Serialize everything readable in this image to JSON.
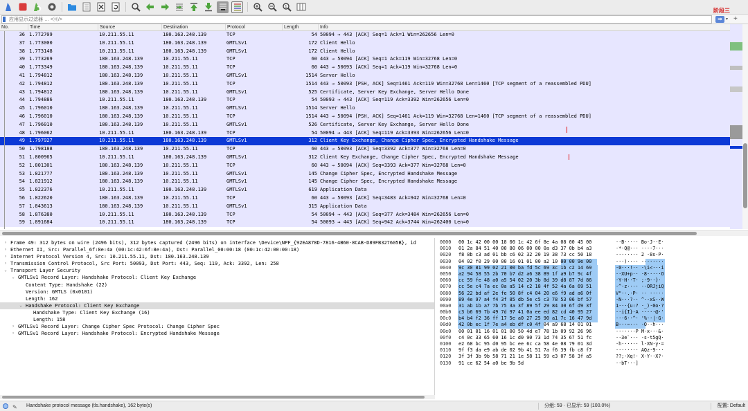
{
  "toolbar": {
    "icons": [
      "shark-fin-start-icon",
      "stop-square-icon",
      "restart-fin-icon",
      "capture-options-gear-icon",
      "open-folder-icon",
      "save-file-icon",
      "close-file-icon",
      "reload-icon",
      "find-packet-icon",
      "go-back-icon",
      "go-forward-icon",
      "go-to-packet-icon",
      "go-first-icon",
      "go-last-icon",
      "autoscroll-icon",
      "colorize-icon",
      "zoom-in-icon",
      "zoom-out-icon",
      "zoom-reset-icon",
      "resize-columns-icon"
    ],
    "stage_label": "阶段三"
  },
  "filter": {
    "placeholder": "应用显示过滤器 … <⌘/>",
    "apply_glyph": "➡"
  },
  "columns": [
    "No.",
    "Time",
    "Source",
    "Destination",
    "Protocol",
    "Length",
    "Info"
  ],
  "packets": [
    {
      "no": "36",
      "time": "1.772709",
      "src": "10.211.55.11",
      "dst": "180.163.248.139",
      "proto": "TCP",
      "len": "54",
      "info": "50094 → 443 [ACK] Seq=1 Ack=1 Win=262656 Len=0"
    },
    {
      "no": "37",
      "time": "1.773000",
      "src": "10.211.55.11",
      "dst": "180.163.248.139",
      "proto": "GMTLSv1",
      "len": "172",
      "info": "Client Hello"
    },
    {
      "no": "38",
      "time": "1.773148",
      "src": "10.211.55.11",
      "dst": "180.163.248.139",
      "proto": "GMTLSv1",
      "len": "172",
      "info": "Client Hello"
    },
    {
      "no": "39",
      "time": "1.773269",
      "src": "180.163.248.139",
      "dst": "10.211.55.11",
      "proto": "TCP",
      "len": "60",
      "info": "443 → 50094 [ACK] Seq=1 Ack=119 Win=32768 Len=0"
    },
    {
      "no": "40",
      "time": "1.773349",
      "src": "180.163.248.139",
      "dst": "10.211.55.11",
      "proto": "TCP",
      "len": "60",
      "info": "443 → 50093 [ACK] Seq=1 Ack=119 Win=32768 Len=0"
    },
    {
      "no": "41",
      "time": "1.794812",
      "src": "180.163.248.139",
      "dst": "10.211.55.11",
      "proto": "GMTLSv1",
      "len": "1514",
      "info": "Server Hello"
    },
    {
      "no": "42",
      "time": "1.794812",
      "src": "180.163.248.139",
      "dst": "10.211.55.11",
      "proto": "TCP",
      "len": "1514",
      "info": "443 → 50093 [PSH, ACK] Seq=1461 Ack=119 Win=32768 Len=1460 [TCP segment of a reassembled PDU]"
    },
    {
      "no": "43",
      "time": "1.794812",
      "src": "180.163.248.139",
      "dst": "10.211.55.11",
      "proto": "GMTLSv1",
      "len": "525",
      "info": "Certificate, Server Key Exchange, Server Hello Done"
    },
    {
      "no": "44",
      "time": "1.794886",
      "src": "10.211.55.11",
      "dst": "180.163.248.139",
      "proto": "TCP",
      "len": "54",
      "info": "50093 → 443 [ACK] Seq=119 Ack=3392 Win=262656 Len=0"
    },
    {
      "no": "45",
      "time": "1.796010",
      "src": "180.163.248.139",
      "dst": "10.211.55.11",
      "proto": "GMTLSv1",
      "len": "1514",
      "info": "Server Hello"
    },
    {
      "no": "46",
      "time": "1.796010",
      "src": "180.163.248.139",
      "dst": "10.211.55.11",
      "proto": "TCP",
      "len": "1514",
      "info": "443 → 50094 [PSH, ACK] Seq=1461 Ack=119 Win=32768 Len=1460 [TCP segment of a reassembled PDU]"
    },
    {
      "no": "47",
      "time": "1.796010",
      "src": "180.163.248.139",
      "dst": "10.211.55.11",
      "proto": "GMTLSv1",
      "len": "526",
      "info": "Certificate, Server Key Exchange, Server Hello Done"
    },
    {
      "no": "48",
      "time": "1.796062",
      "src": "10.211.55.11",
      "dst": "180.163.248.139",
      "proto": "TCP",
      "len": "54",
      "info": "50094 → 443 [ACK] Seq=119 Ack=3393 Win=262656 Len=0"
    },
    {
      "no": "49",
      "time": "1.797927",
      "src": "10.211.55.11",
      "dst": "180.163.248.139",
      "proto": "GMTLSv1",
      "len": "312",
      "info": "Client Key Exchange, Change Cipher Spec, Encrypted Handshake Message"
    },
    {
      "no": "50",
      "time": "1.798188",
      "src": "180.163.248.139",
      "dst": "10.211.55.11",
      "proto": "TCP",
      "len": "60",
      "info": "443 → 50093 [ACK] Seq=3392 Ack=377 Win=32768 Len=0"
    },
    {
      "no": "51",
      "time": "1.800965",
      "src": "10.211.55.11",
      "dst": "180.163.248.139",
      "proto": "GMTLSv1",
      "len": "312",
      "info": "Client Key Exchange, Change Cipher Spec, Encrypted Handshake Message"
    },
    {
      "no": "52",
      "time": "1.801301",
      "src": "180.163.248.139",
      "dst": "10.211.55.11",
      "proto": "TCP",
      "len": "60",
      "info": "443 → 50094 [ACK] Seq=3393 Ack=377 Win=32768 Len=0"
    },
    {
      "no": "53",
      "time": "1.821777",
      "src": "180.163.248.139",
      "dst": "10.211.55.11",
      "proto": "GMTLSv1",
      "len": "145",
      "info": "Change Cipher Spec, Encrypted Handshake Message"
    },
    {
      "no": "54",
      "time": "1.821912",
      "src": "180.163.248.139",
      "dst": "10.211.55.11",
      "proto": "GMTLSv1",
      "len": "145",
      "info": "Change Cipher Spec, Encrypted Handshake Message"
    },
    {
      "no": "55",
      "time": "1.822376",
      "src": "10.211.55.11",
      "dst": "180.163.248.139",
      "proto": "GMTLSv1",
      "len": "619",
      "info": "Application Data"
    },
    {
      "no": "56",
      "time": "1.822620",
      "src": "180.163.248.139",
      "dst": "10.211.55.11",
      "proto": "TCP",
      "len": "60",
      "info": "443 → 50093 [ACK] Seq=3483 Ack=942 Win=32768 Len=0"
    },
    {
      "no": "57",
      "time": "1.843613",
      "src": "180.163.248.139",
      "dst": "10.211.55.11",
      "proto": "GMTLSv1",
      "len": "315",
      "info": "Application Data"
    },
    {
      "no": "58",
      "time": "1.876380",
      "src": "10.211.55.11",
      "dst": "180.163.248.139",
      "proto": "TCP",
      "len": "54",
      "info": "50094 → 443 [ACK] Seq=377 Ack=3484 Win=262656 Len=0"
    },
    {
      "no": "59",
      "time": "1.891684",
      "src": "10.211.55.11",
      "dst": "180.163.248.139",
      "proto": "TCP",
      "len": "54",
      "info": "50093 → 443 [ACK] Seq=942 Ack=3744 Win=262400 Len=0"
    }
  ],
  "selected_packet": "49",
  "details": [
    {
      "indent": 0,
      "arrow": "›",
      "text": "Frame 49: 312 bytes on wire (2496 bits), 312 bytes captured (2496 bits) on interface \\Device\\NPF_{92EA878D-7816-4B60-8CAB-D89FB327605B}, id"
    },
    {
      "indent": 0,
      "arrow": "›",
      "text": "Ethernet II, Src: Parallel_6f:8e:4a (00:1c:42:6f:8e:4a), Dst: Parallel_00:00:18 (00:1c:42:00:00:18)"
    },
    {
      "indent": 0,
      "arrow": "›",
      "text": "Internet Protocol Version 4, Src: 10.211.55.11, Dst: 180.163.248.139"
    },
    {
      "indent": 0,
      "arrow": "›",
      "text": "Transmission Control Protocol, Src Port: 50093, Dst Port: 443, Seq: 119, Ack: 3392, Len: 258"
    },
    {
      "indent": 0,
      "arrow": "⌄",
      "text": "Transport Layer Security"
    },
    {
      "indent": 1,
      "arrow": "⌄",
      "text": "GMTLSv1 Record Layer: Handshake Protocol: Client Key Exchange"
    },
    {
      "indent": 2,
      "arrow": "",
      "text": "Content Type: Handshake (22)"
    },
    {
      "indent": 2,
      "arrow": "",
      "text": "Version: GMTLS (0x0101)"
    },
    {
      "indent": 2,
      "arrow": "",
      "text": "Length: 162"
    },
    {
      "indent": 2,
      "arrow": "⌄",
      "text": "Handshake Protocol: Client Key Exchange",
      "highlight": true
    },
    {
      "indent": 3,
      "arrow": "",
      "text": "Handshake Type: Client Key Exchange (16)"
    },
    {
      "indent": 3,
      "arrow": "",
      "text": "Length: 158"
    },
    {
      "indent": 1,
      "arrow": "›",
      "text": "GMTLSv1 Record Layer: Change Cipher Spec Protocol: Change Cipher Spec"
    },
    {
      "indent": 1,
      "arrow": "›",
      "text": "GMTLSv1 Record Layer: Handshake Protocol: Encrypted Handshake Message"
    }
  ],
  "bytes": [
    {
      "off": "0000",
      "hex": "00 1c 42 00 00 18 00 1c  42 6f 8e 4a 08 00 45 00",
      "ascii": "··B····· Bo·J··E·"
    },
    {
      "off": "0010",
      "hex": "01 2a 84 51 40 00 80 06  00 00 0a d3 37 0b b4 a3",
      "ascii": "·*·Q@··· ····7···"
    },
    {
      "off": "0020",
      "hex": "f8 8b c3 ad 01 bb c6 02  32 20 19 38 73 cc 50 18",
      "ascii": "········ 2 ·8s·P·"
    },
    {
      "off": "0030",
      "hex": "04 02 f0 29 00 00 16 01  01 00 a2 10 00 00 9e 00",
      "ascii": "···)···· ········"
    },
    {
      "off": "0040",
      "hex": "9c 30 81 99 02 21 00 ba  fd 5c 69 3c 1b c2 14 69",
      "ascii": "·0···!·· ·\\i<···i"
    },
    {
      "off": "0050",
      "hex": "a2 94 58 55 2b 70 b7 d2  a6 38 89 1f a9 b7 9c 4f",
      "ascii": "··XU+p·· ·8·····O"
    },
    {
      "off": "0060",
      "hex": "cc 59 fe 48 a0 a5 54 02  20 3b 8d 39 d8 87 7d 86",
      "ascii": "·Y·H··T·  ;·9··}·"
    },
    {
      "off": "0070",
      "hex": "cc 5e c4 7a ec 0a a5 14  c2 18 4f 52 4a 6a 69 51",
      "ascii": "·^·z···· ··ORJjiQ"
    },
    {
      "off": "0080",
      "hex": "56 22 bd af 2e fe 50 8f  c4 04 20 e6 f9 ad a6 0f",
      "ascii": "V\"··.·P· ·· ·····"
    },
    {
      "off": "0090",
      "hex": "89 4e 97 a4 f4 3f 85 db  5e c5 c3 78 53 06 bf 57",
      "ascii": "·N···?·· ^··xS··W"
    },
    {
      "off": "00a0",
      "hex": "31 ab 1b a7 7b 75 3a 3f  89 5f 29 84 30 6f d9 3f",
      "ascii": "1···{u:? ·_)·0o·?"
    },
    {
      "off": "00b0",
      "hex": "c3 b6 69 7b 49 7d 97 41  0a ee ed 82 cd 40 95 27",
      "ascii": "··i{I}·A ·····@·'"
    },
    {
      "off": "00c0",
      "hex": "b4 b4 f2 36 ff 17 5e a0  27 25 90 a1 7c 16 47 9d",
      "ascii": "···6··^· '%··|·G·"
    },
    {
      "off": "00d0",
      "hex": "42 0b ec 1f 7e a4 eb df  c0 4f 04 a9 68 14 01 01",
      "ascii": "B···~··· ·O··h···"
    },
    {
      "off": "00e0",
      "hex": "00 01 01 16 01 01 00 50  4d e7 78 1b 09 92 26 96",
      "ascii": "·······P M·x···&·"
    },
    {
      "off": "00f0",
      "hex": "c4 0c 33 65 60 16 1c d0  90 73 1d 74 35 67 51 fc",
      "ascii": "··3e`··· ·s·t5gQ·"
    },
    {
      "off": "0100",
      "hex": "e2 68 bc 95 d0 95 bc ee  6c ca 58 4e 08 79 01 3d",
      "ascii": "·h······ l·XN·y·="
    },
    {
      "off": "0110",
      "hex": "9f f3 da e9 ab de 02 9b  41 51 7a f6 39 fb c8 f7",
      "ascii": "········ AQz·9···"
    },
    {
      "off": "0120",
      "hex": "3f 3f 3b 9b 58 71 21 1e  58 11 59 e3 07 58 3f a5",
      "ascii": "??;·Xq!· X·Y··X?·"
    },
    {
      "off": "0130",
      "hex": "91 ce 62 54 a0 be 9b 5d",
      "ascii": "··bT···]"
    }
  ],
  "status": {
    "text": "Handshake protocol message (tls.handshake), 162 byte(s)",
    "packets": "分组: 59 · 已显示: 59 (100.0%)",
    "profile": "配置: Default"
  },
  "colors": {
    "row_bg": "#e7e6ff",
    "selected_bg": "#0c39d6",
    "byte_highlight": "#9ecbf5",
    "stage_label": "#d21b1b"
  }
}
